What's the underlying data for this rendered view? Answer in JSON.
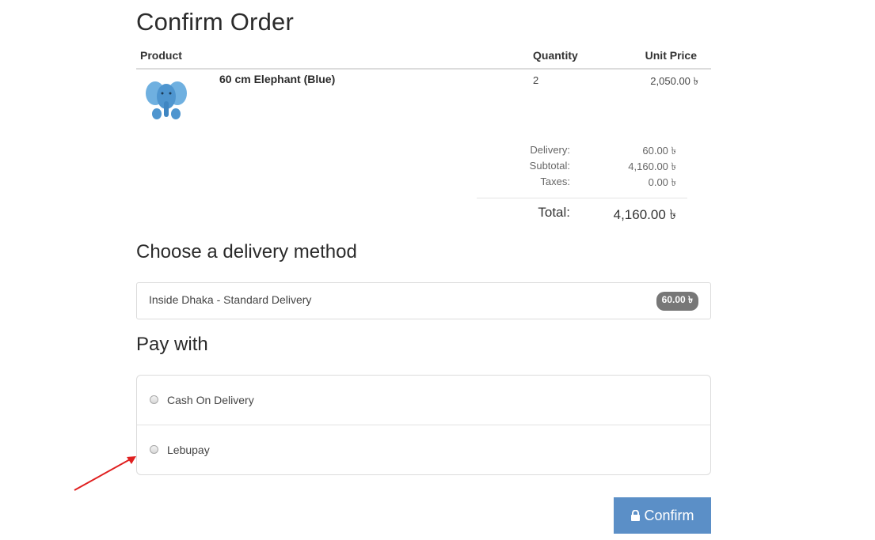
{
  "page": {
    "title": "Confirm Order"
  },
  "cart": {
    "headers": {
      "product": "Product",
      "quantity": "Quantity",
      "unit_price": "Unit Price"
    },
    "items": [
      {
        "name": "60 cm Elephant (Blue)",
        "quantity": "2",
        "unit_price": "2,050.00 ৳"
      }
    ]
  },
  "totals": {
    "delivery_label": "Delivery:",
    "delivery_value": "60.00 ৳",
    "subtotal_label": "Subtotal:",
    "subtotal_value": "4,160.00 ৳",
    "taxes_label": "Taxes:",
    "taxes_value": "0.00 ৳",
    "total_label": "Total:",
    "total_value": "4,160.00 ৳"
  },
  "delivery": {
    "heading": "Choose a delivery method",
    "method_label": "Inside Dhaka - Standard Delivery",
    "method_price": "60.00 ৳"
  },
  "payment": {
    "heading": "Pay with",
    "options": [
      {
        "label": "Cash On Delivery"
      },
      {
        "label": "Lebupay"
      }
    ]
  },
  "actions": {
    "confirm_label": "Confirm",
    "confirm_icon": "lock-icon"
  },
  "colors": {
    "confirm_bg": "#5b8fc7",
    "badge_bg": "#777777",
    "arrow": "#e02020",
    "product_blue": "#5aa0d8"
  }
}
